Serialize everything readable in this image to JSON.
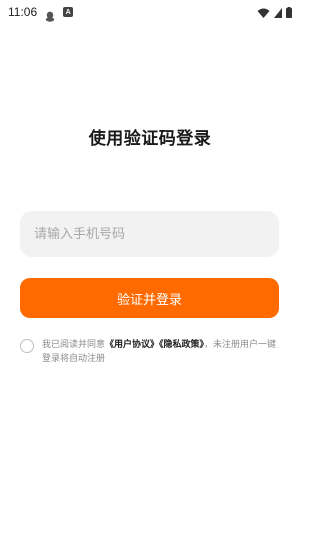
{
  "status_bar": {
    "time": "11:06",
    "icons": [
      "qq-icon",
      "a-icon",
      "wifi-icon",
      "battery-icon"
    ]
  },
  "login": {
    "title": "使用验证码登录",
    "phone_placeholder": "请输入手机号码",
    "phone_value": "",
    "submit_label": "验证并登录"
  },
  "agreement": {
    "checked": false,
    "prefix": "我已阅读并同意",
    "user_agreement": "《用户协议》",
    "privacy_policy": "《隐私政策》",
    "suffix": "，未注册用户一键登录将自动注册"
  },
  "colors": {
    "accent": "#ff6a00",
    "input_bg": "#f2f2f2",
    "muted_text": "#8a8a8a"
  }
}
